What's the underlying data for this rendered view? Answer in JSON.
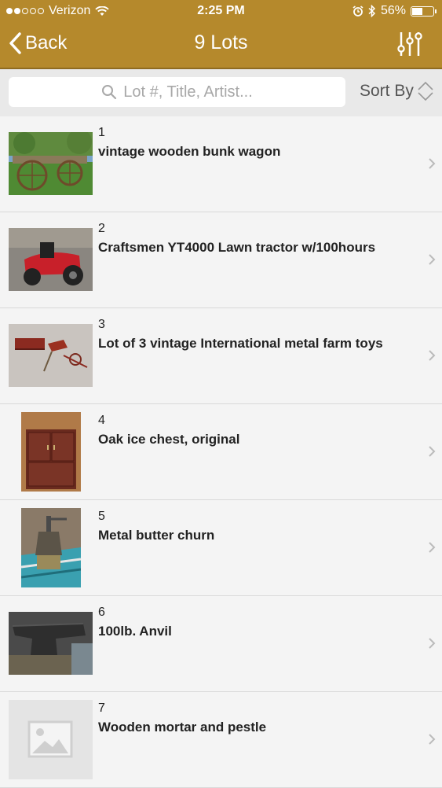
{
  "status_bar": {
    "carrier": "Verizon",
    "time": "2:25 PM",
    "battery": "56%",
    "battery_level": 0.56
  },
  "nav": {
    "back_label": "Back",
    "title": "9 Lots"
  },
  "search": {
    "placeholder": "Lot #, Title, Artist...",
    "sort_label": "Sort By"
  },
  "lots": [
    {
      "number": "1",
      "title": "vintage wooden bunk wagon"
    },
    {
      "number": "2",
      "title": "Craftsmen YT4000 Lawn tractor w/100hours"
    },
    {
      "number": "3",
      "title": "Lot of 3 vintage International metal farm toys"
    },
    {
      "number": "4",
      "title": "Oak ice chest, original"
    },
    {
      "number": "5",
      "title": "Metal butter churn"
    },
    {
      "number": "6",
      "title": "100lb. Anvil"
    },
    {
      "number": "7",
      "title": "Wooden mortar and pestle"
    }
  ],
  "colors": {
    "brand": "#b5892c",
    "background": "#f4f4f4"
  }
}
